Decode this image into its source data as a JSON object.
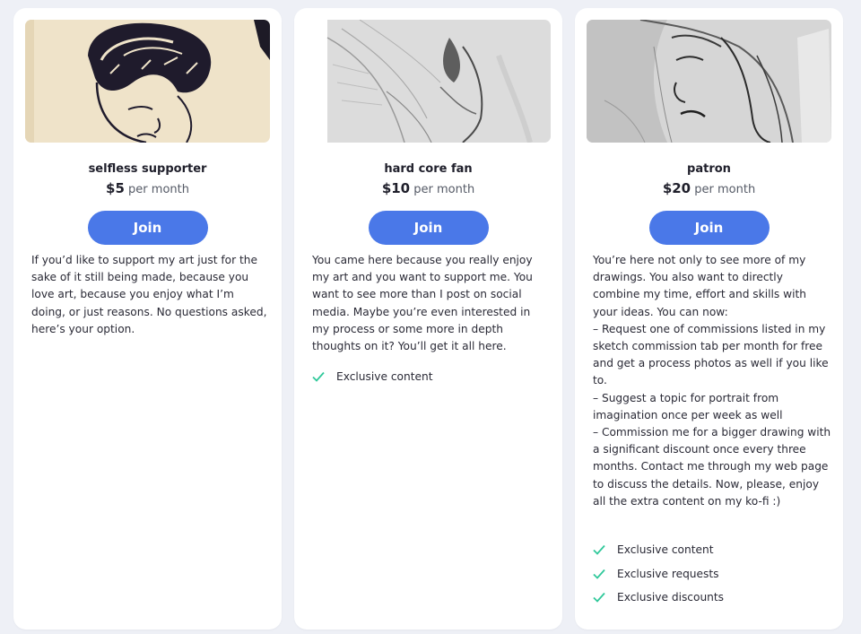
{
  "accent_color": "#4a78e8",
  "check_color": "#2fc89a",
  "tiers": [
    {
      "name": "selfless supporter",
      "price": "$5",
      "period": "per month",
      "join_label": "Join",
      "image_icon": "boy-sketch-image",
      "description": "If you’d like to support my art just for the sake of it still being made, because you love art, because you enjoy what I’m doing, or just reasons. No questions asked, here’s your option.",
      "benefits": []
    },
    {
      "name": "hard core fan",
      "price": "$10",
      "period": "per month",
      "join_label": "Join",
      "image_icon": "pencil-sketch-image",
      "description": "You came here because you really enjoy my art and you want to support me. You want to see more than I post on social media. Maybe you’re even interested in my process or some more in depth thoughts on it? You’ll get it all here.",
      "benefits": [
        "Exclusive content"
      ]
    },
    {
      "name": "patron",
      "price": "$20",
      "period": "per month",
      "join_label": "Join",
      "image_icon": "portrait-sketch-image",
      "description": "You’re here not only to see more of my drawings. You also want to directly combine my time, effort and skills with your ideas. You can now:\n– Request one of commissions listed in my sketch commission tab per month for free and get a process photos as well if you like to.\n– Suggest a topic for portrait from imagination once per week as well\n– Commission me for a bigger drawing with a significant discount once every three months. Contact me through my web page to discuss the details. Now, please, enjoy all the extra content on my ko-fi :)",
      "benefits": [
        "Exclusive content",
        "Exclusive requests",
        "Exclusive discounts"
      ]
    }
  ]
}
